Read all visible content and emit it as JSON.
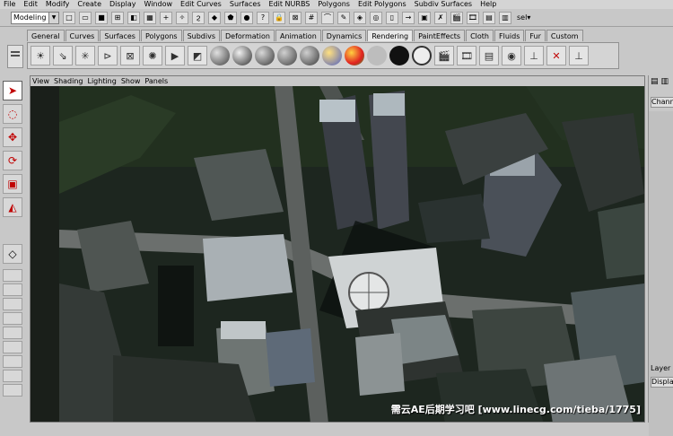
{
  "menubar": [
    "File",
    "Edit",
    "Modify",
    "Create",
    "Display",
    "Window",
    "Edit Curves",
    "Surfaces",
    "Edit NURBS",
    "Polygons",
    "Edit Polygons",
    "Subdiv Surfaces",
    "Help"
  ],
  "statusline": {
    "mode": "Modeling",
    "selection_label": "sel▾"
  },
  "shelf_tabs": [
    "General",
    "Curves",
    "Surfaces",
    "Polygons",
    "Subdivs",
    "Deformation",
    "Animation",
    "Dynamics",
    "Rendering",
    "PaintEffects",
    "Cloth",
    "Fluids",
    "Fur",
    "Custom"
  ],
  "active_shelf_tab": "Rendering",
  "viewport": {
    "menu": [
      "View",
      "Shading",
      "Lighting",
      "Show",
      "Panels"
    ],
    "watermark": "需云AE后期学习吧 [www.linecg.com/tieba/1775]"
  },
  "channel_box": {
    "label": "Channe",
    "layer_label": "Layer",
    "display_label": "Displa"
  },
  "colors": {
    "window_bg": "#c8c8c8",
    "viewport_bg": "#1a1f1a",
    "selection_red": "#c00000"
  }
}
